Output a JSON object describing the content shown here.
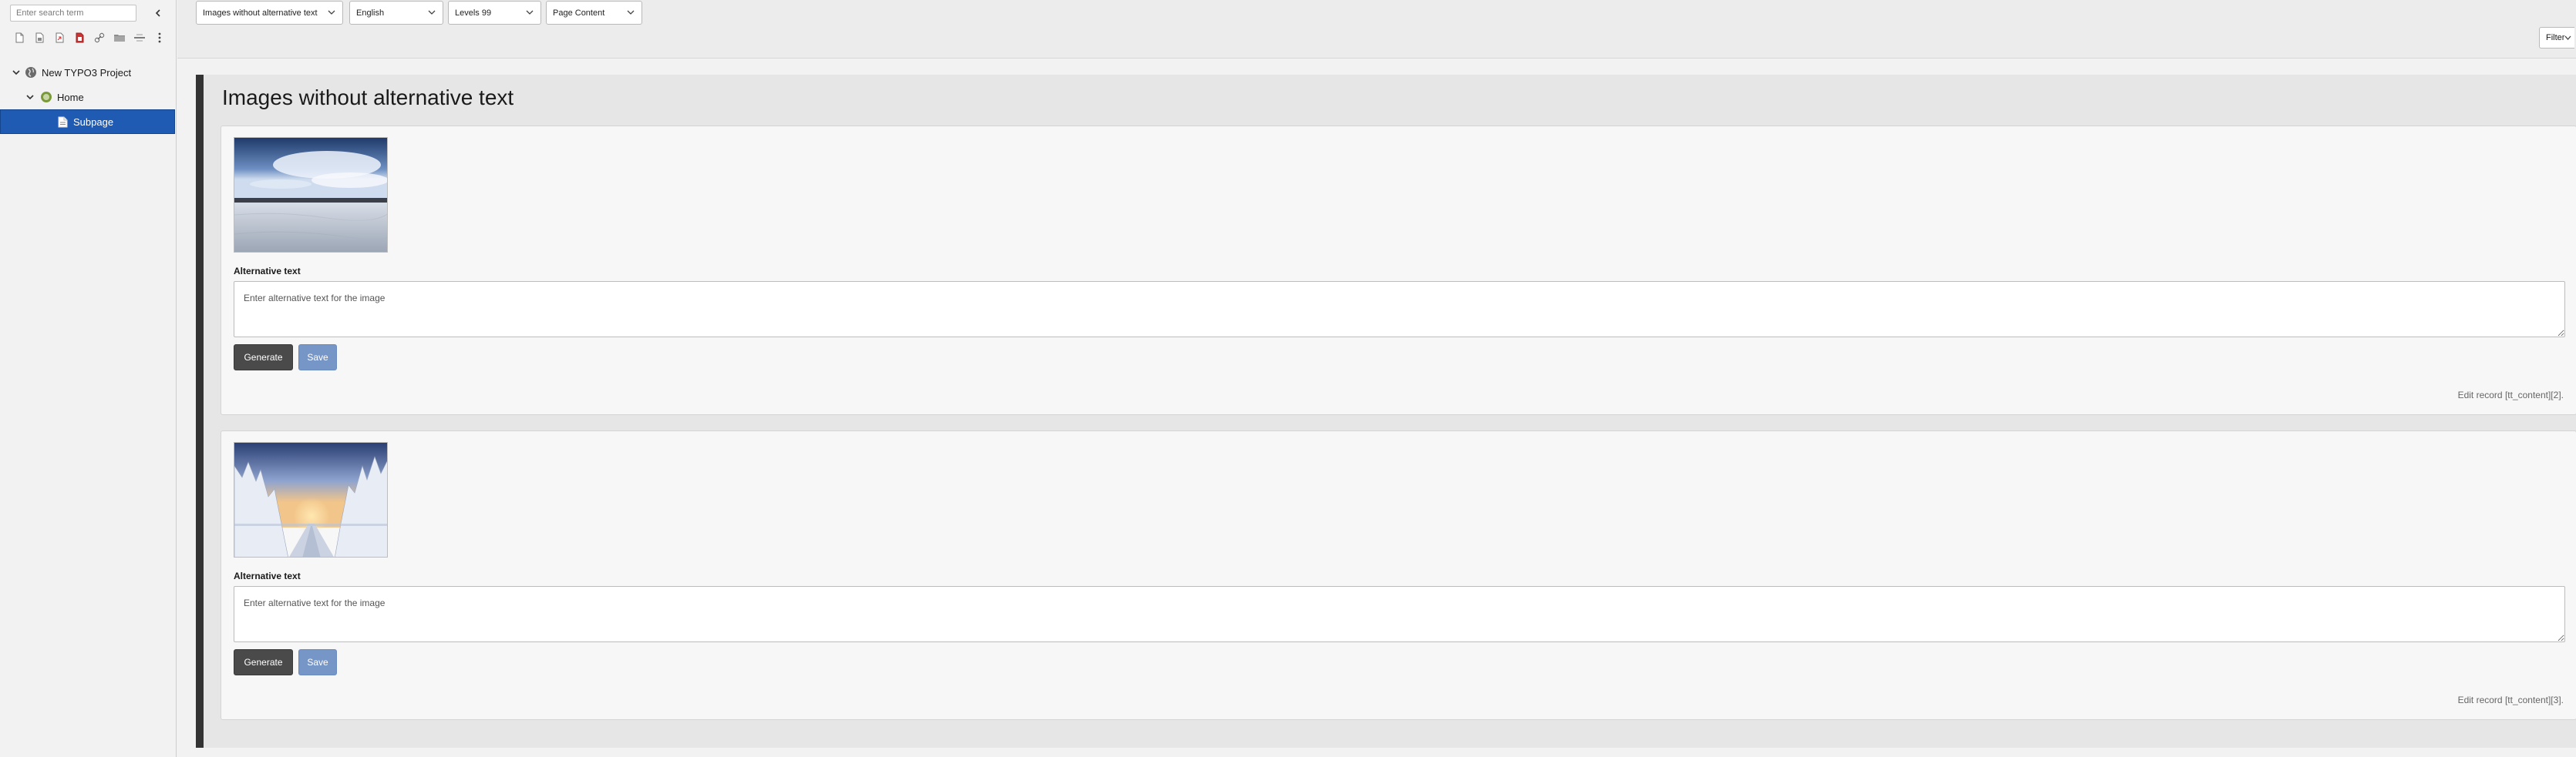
{
  "tree": {
    "search_placeholder": "Enter search term",
    "nodes": [
      {
        "label": "New TYPO3 Project",
        "icon": "site-globe-icon",
        "expanded": true
      },
      {
        "label": "Home",
        "icon": "home-page-icon",
        "expanded": true
      },
      {
        "label": "Subpage",
        "icon": "page-icon",
        "selected": true
      }
    ],
    "toolbar_icons": [
      "new-page-icon",
      "new-folder-icon",
      "new-shortcut-icon",
      "new-mountpoint-icon",
      "link-icon",
      "folder-icon",
      "separator-icon",
      "more-vertical-icon"
    ]
  },
  "topbar": {
    "dropdowns": {
      "report": "Images without alternative text",
      "language": "English",
      "levels": "Levels 99",
      "content_type": "Page Content"
    },
    "filter_label": "Filter"
  },
  "main": {
    "title": "Images without alternative text",
    "cards": [
      {
        "image": "snowy-landscape-cloudy-sky",
        "alt_label": "Alternative text",
        "alt_placeholder": "Enter alternative text for the image",
        "generate_label": "Generate",
        "save_label": "Save",
        "edit_link": "Edit record [tt_content][2]."
      },
      {
        "image": "snowy-forest-road-sunset",
        "alt_label": "Alternative text",
        "alt_placeholder": "Enter alternative text for the image",
        "generate_label": "Generate",
        "save_label": "Save",
        "edit_link": "Edit record [tt_content][3]."
      }
    ]
  },
  "colors": {
    "selected_node": "#1f5bb3",
    "generate_button": "#4a4a4a",
    "save_button": "#7796c8",
    "panel_accent": "#333333"
  }
}
